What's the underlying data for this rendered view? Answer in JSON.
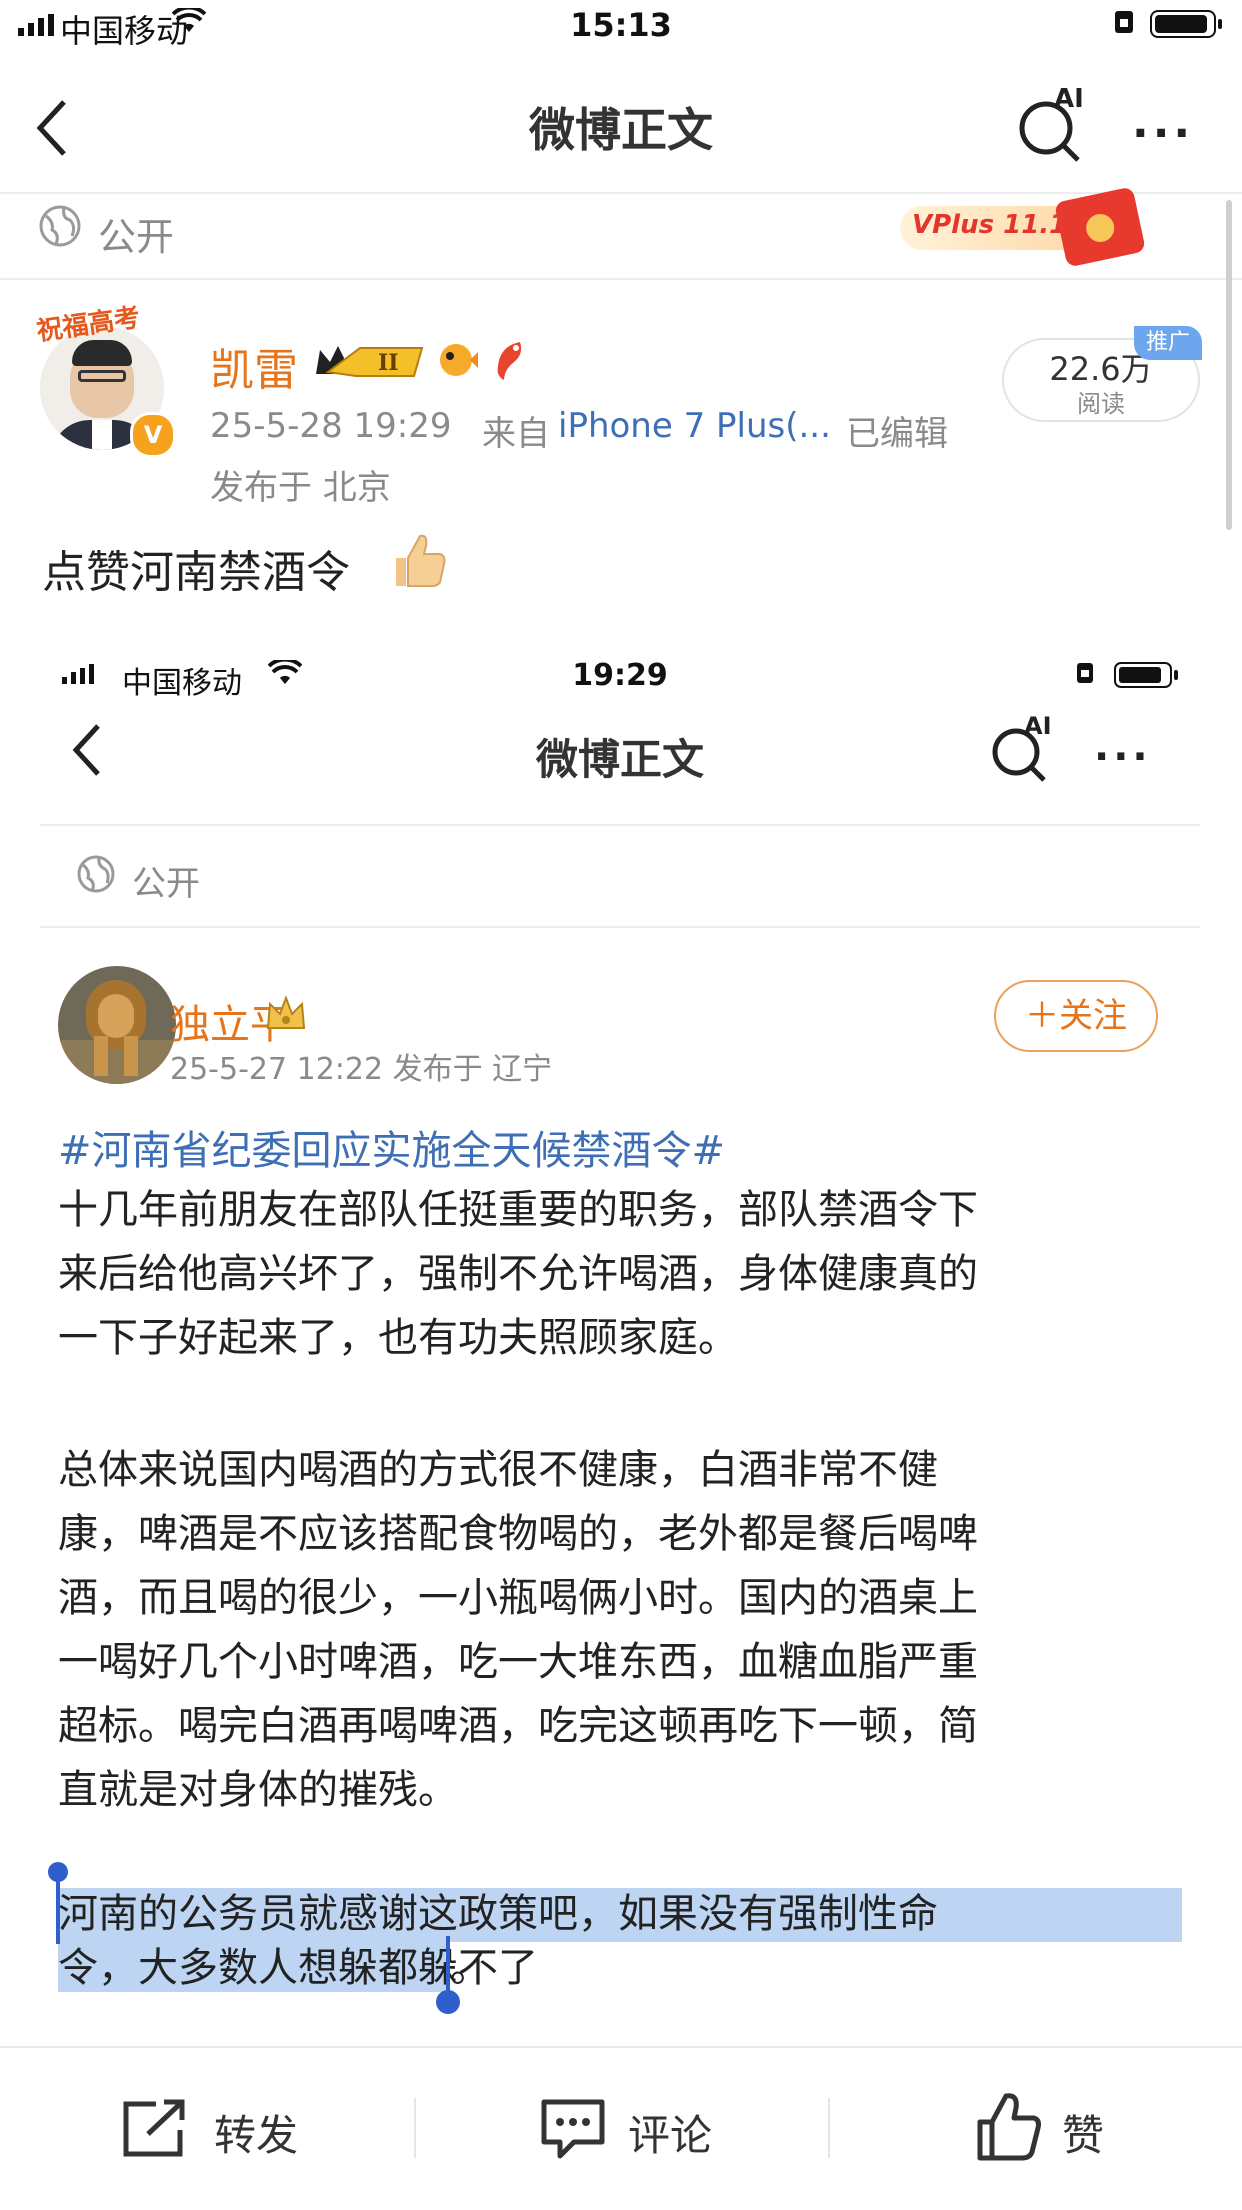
{
  "status_bar": {
    "carrier": "中国移动",
    "time": "15:13"
  },
  "nav": {
    "title": "微博正文",
    "ai_label": "AI",
    "more": "···"
  },
  "visibility": {
    "label": "公开",
    "banner": "VPlus 11.11"
  },
  "post": {
    "author": "凯雷",
    "avatar_banner": "祝福高考",
    "timestamp": "25-5-28 19:29",
    "source_prefix": "来自",
    "source_device": "iPhone 7 Plus(...",
    "edited": "已编辑",
    "location": "发布于 北京",
    "text": "点赞河南禁酒令",
    "reads_count": "22.6万",
    "reads_label": "阅读",
    "promo_badge": "推广"
  },
  "embedded": {
    "status_bar": {
      "carrier": "中国移动",
      "time": "19:29"
    },
    "nav": {
      "title": "微博正文",
      "ai_label": "AI",
      "more": "···"
    },
    "visibility": "公开",
    "author": "独立平",
    "meta": "25-5-27 12:22  发布于 辽宁",
    "follow_button": "＋关注",
    "hashtag": "#河南省纪委回应实施全天候禁酒令#",
    "paragraph1": "十几年前朋友在部队任挺重要的职务，部队禁酒令下\n来后给他高兴坏了，强制不允许喝酒，身体健康真的\n一下子好起来了，也有功夫照顾家庭。",
    "paragraph2": "总体来说国内喝酒的方式很不健康，白酒非常不健\n康，啤酒是不应该搭配食物喝的，老外都是餐后喝啤\n酒，而且喝的很少，一小瓶喝俩小时。国内的酒桌上\n一喝好几个小时啤酒，吃一大堆东西，血糖血脂严重\n超标。喝完白酒再喝啤酒，吃完这顿再吃下一顿，简\n直就是对身体的摧残。",
    "paragraph3_line1": "河南的公务员就感谢这政策吧，如果没有强制性命",
    "paragraph3_line2": "令，大多数人想躲都躲不了",
    "paragraph3_tail": "。"
  },
  "toolbar": {
    "repost": "转发",
    "comment": "评论",
    "like": "赞"
  },
  "colors": {
    "accent_orange": "#e5741a",
    "link_blue": "#3e6fb5",
    "selection": "#bdd5f2",
    "handle": "#2f5fcc"
  }
}
